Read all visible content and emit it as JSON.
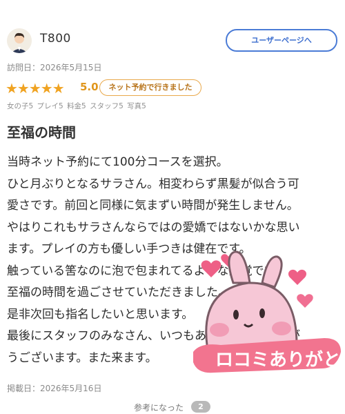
{
  "review": {
    "username": "T800",
    "user_page_label": "ユーザーページへ",
    "visit_date": "訪問日：2026年5月15日",
    "stars": "★★★★★",
    "rating": "5.0",
    "net_badge": "ネット予約で行きました",
    "subscores": [
      "女の子5",
      "プレイ5",
      "料金5",
      "スタッフ5",
      "写真5"
    ],
    "title": "至福の時間",
    "body_lines": [
      "当時ネット予約にて100分コースを選択。",
      "ひと月ぶりとなるサラさん。相変わらず黒髪が似合う可",
      "愛さです。前回と同様に気まずい時間が発生しません。",
      "やはりこれもサラさんならではの愛嬌ではないかな思い",
      "ます。プレイの方も優しい手つきは健在です。",
      "触っている筈なのに泡で包まれてるような感覚です。",
      "至福の時間を過ごさせていただきました。",
      "是非次回も指名したいと思います。",
      "最後にスタッフのみなさん、いつもありがとうございが",
      "うございます。また来ます。"
    ],
    "posted_date": "掲載日：2026年5月16日",
    "helpful_label": "参考になった",
    "helpful_count": "2"
  },
  "sticker": {
    "text": "ロコミありがと"
  },
  "colors": {
    "accent_blue": "#4a7bd6",
    "star": "#f0a322",
    "badge_orange": "#e9a84a",
    "sticker_pink": "#f6c7d6"
  }
}
